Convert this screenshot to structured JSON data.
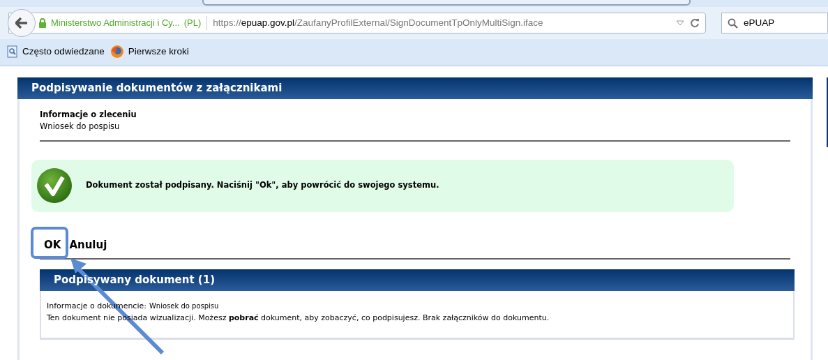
{
  "browser": {
    "site_identity": "Ministerstwo Administracji i Cy...",
    "site_country": "(PL)",
    "url": {
      "scheme": "https://",
      "host": "epuap.gov.pl",
      "path": "/ZaufanyProfilExternal/SignDocumentTpOnlyMultiSign.iface"
    },
    "search": {
      "value": "ePUAP"
    },
    "bookmarks": [
      {
        "kind": "page",
        "label": "Często odwiedzane"
      },
      {
        "kind": "firefox",
        "label": "Pierwsze kroki"
      }
    ]
  },
  "page": {
    "title": "Podpisywanie dokumentów z załącznikami",
    "order_info": {
      "heading": "Informacje o zleceniu",
      "value": "Wniosek do pospisu"
    },
    "message": {
      "kind": "success",
      "text": "Dokument został podpisany. Naciśnij \"Ok\", aby powrócić do swojego systemu."
    },
    "buttons": [
      "OK",
      "Anuluj"
    ],
    "document_panel": {
      "title": "Podpisywany dokument (1)",
      "info_label": "Informacje o dokumencie:",
      "info_value": "Wniosek do pospisu",
      "note": "Ten dokument nie posiada wizualizacji. Możesz **pobrać** dokument, aby zobaczyć, co podpisujesz. Brak załączników do dokumentu."
    }
  }
}
